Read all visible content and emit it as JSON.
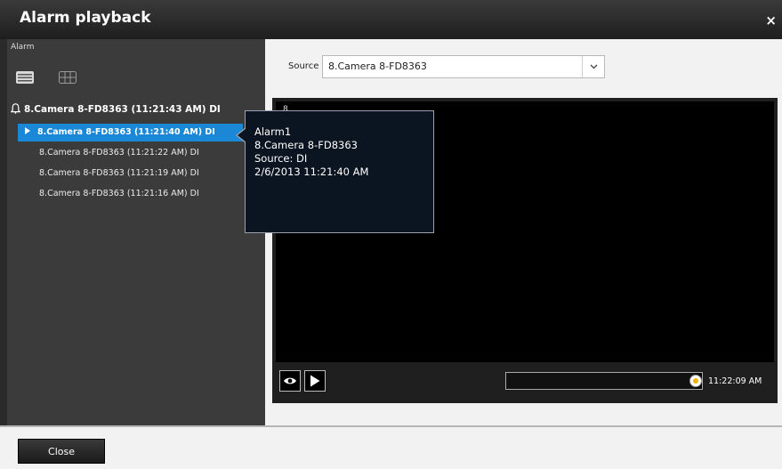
{
  "window": {
    "title": "Alarm playback",
    "close_glyph": "×"
  },
  "left_panel": {
    "label": "Alarm",
    "view_icons": [
      "list-view-icon",
      "grid-view-icon"
    ],
    "group": {
      "label": "8.Camera 8-FD8363 (11:21:43 AM) DI",
      "icon": "bell-icon"
    },
    "items": [
      {
        "label": "8.Camera 8-FD8363 (11:21:40 AM) DI",
        "selected": true
      },
      {
        "label": "8.Camera 8-FD8363 (11:21:22 AM) DI",
        "selected": false
      },
      {
        "label": "8.Camera 8-FD8363 (11:21:19 AM) DI",
        "selected": false
      },
      {
        "label": "8.Camera 8-FD8363 (11:21:16 AM) DI",
        "selected": false
      }
    ]
  },
  "tooltip": {
    "line1": "Alarm1",
    "line2": "8.Camera 8-FD8363",
    "line3": "Source: DI",
    "line4": "2/6/2013 11:21:40 AM"
  },
  "source": {
    "label": "Source",
    "value": "8.Camera 8-FD8363"
  },
  "video": {
    "camera_number": "8",
    "time_label": "11:22:09 AM",
    "timeline_position_pct": 97
  },
  "footer": {
    "close_label": "Close"
  },
  "colors": {
    "selection": "#1a88d6",
    "knob_accent": "#f0b400"
  }
}
